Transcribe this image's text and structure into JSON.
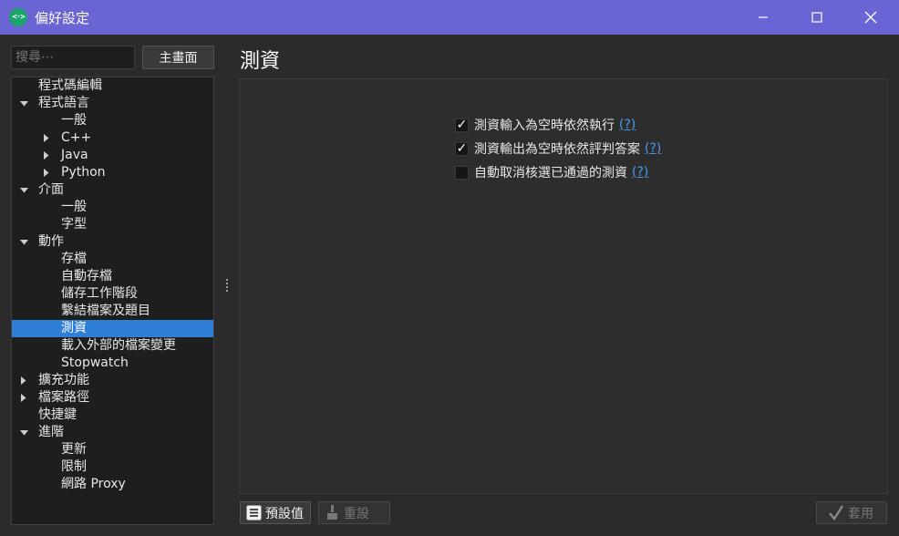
{
  "window": {
    "title": "偏好設定",
    "app_icon_glyph": "<·>",
    "buttons": [
      "minimize-icon",
      "maximize-icon",
      "close-icon"
    ]
  },
  "sidebar": {
    "search_placeholder": "搜尋⋯",
    "home_label": "主畫面",
    "items": [
      {
        "label": "程式碼編輯",
        "level": 0,
        "expander": "none"
      },
      {
        "label": "程式語言",
        "level": 0,
        "expander": "expanded"
      },
      {
        "label": "一般",
        "level": 1,
        "expander": "none"
      },
      {
        "label": "C++",
        "level": 1,
        "expander": "collapsed"
      },
      {
        "label": "Java",
        "level": 1,
        "expander": "collapsed"
      },
      {
        "label": "Python",
        "level": 1,
        "expander": "collapsed"
      },
      {
        "label": "介面",
        "level": 0,
        "expander": "expanded"
      },
      {
        "label": "一般",
        "level": 1,
        "expander": "none"
      },
      {
        "label": "字型",
        "level": 1,
        "expander": "none"
      },
      {
        "label": "動作",
        "level": 0,
        "expander": "expanded"
      },
      {
        "label": "存檔",
        "level": 1,
        "expander": "none"
      },
      {
        "label": "自動存檔",
        "level": 1,
        "expander": "none"
      },
      {
        "label": "儲存工作階段",
        "level": 1,
        "expander": "none"
      },
      {
        "label": "繫結檔案及題目",
        "level": 1,
        "expander": "none"
      },
      {
        "label": "測資",
        "level": 1,
        "expander": "none",
        "selected": true
      },
      {
        "label": "載入外部的檔案變更",
        "level": 1,
        "expander": "none"
      },
      {
        "label": "Stopwatch",
        "level": 1,
        "expander": "none"
      },
      {
        "label": "擴充功能",
        "level": 0,
        "expander": "collapsed"
      },
      {
        "label": "檔案路徑",
        "level": 0,
        "expander": "collapsed"
      },
      {
        "label": "快捷鍵",
        "level": 0,
        "expander": "none"
      },
      {
        "label": "進階",
        "level": 0,
        "expander": "expanded"
      },
      {
        "label": "更新",
        "level": 1,
        "expander": "none"
      },
      {
        "label": "限制",
        "level": 1,
        "expander": "none"
      },
      {
        "label": "網路 Proxy",
        "level": 1,
        "expander": "none"
      }
    ]
  },
  "main": {
    "title": "測資",
    "options": [
      {
        "label": "測資輸入為空時依然執行",
        "checked": true,
        "help": "(?)"
      },
      {
        "label": "測資輸出為空時依然評判答案",
        "checked": true,
        "help": "(?)"
      },
      {
        "label": "自動取消核選已通過的測資",
        "checked": false,
        "help": "(?)"
      }
    ]
  },
  "footer": {
    "defaults_label": "預設值",
    "reset_label": "重設",
    "apply_label": "套用"
  },
  "colors": {
    "titlebar": "#6b64d4",
    "selection": "#2f7fd6",
    "link": "#4a9cf0"
  }
}
